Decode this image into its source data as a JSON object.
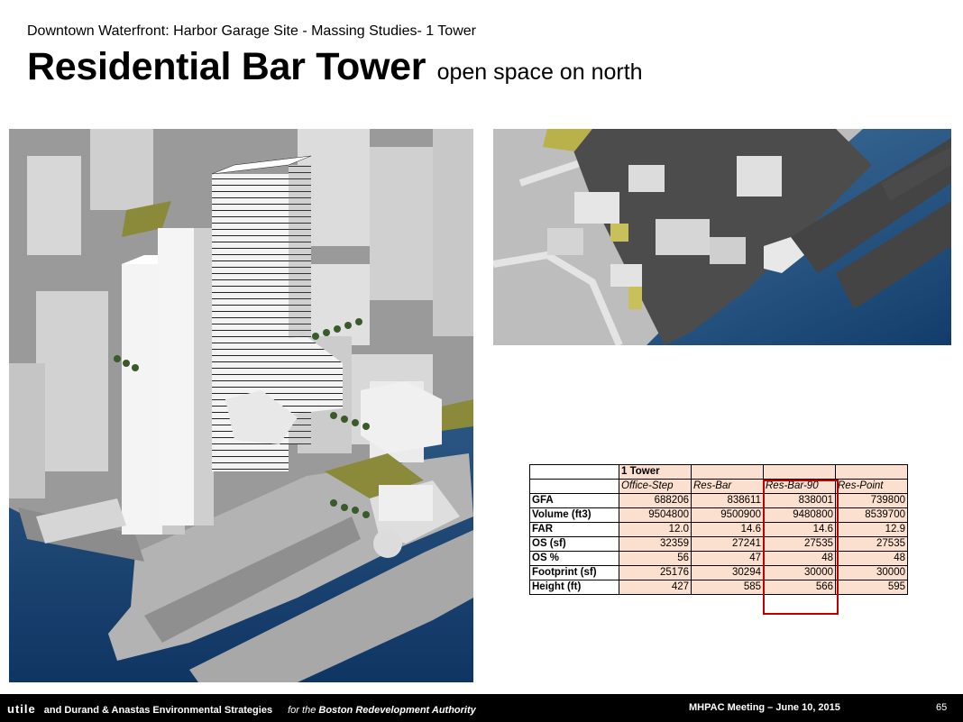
{
  "header": {
    "subtitle": "Downtown Waterfront: Harbor Garage Site - Massing Studies- 1 Tower",
    "title": "Residential Bar Tower",
    "title_suffix": "open space on north"
  },
  "table": {
    "group_label": "1 Tower",
    "columns": [
      "Office-Step",
      "Res-Bar",
      "Res-Bar-90",
      "Res-Point"
    ],
    "highlighted_column": "Res-Bar-90",
    "rows": [
      {
        "label": "GFA",
        "values": [
          "688206",
          "838611",
          "838001",
          "739800"
        ]
      },
      {
        "label": "Volume (ft3)",
        "values": [
          "9504800",
          "9500900",
          "9480800",
          "8539700"
        ]
      },
      {
        "label": "FAR",
        "values": [
          "12.0",
          "14.6",
          "14.6",
          "12.9"
        ]
      },
      {
        "label": "OS (sf)",
        "values": [
          "32359",
          "27241",
          "27535",
          "27535"
        ]
      },
      {
        "label": "OS %",
        "values": [
          "56",
          "47",
          "48",
          "48"
        ]
      },
      {
        "label": "Footprint (sf)",
        "values": [
          "25176",
          "30294",
          "30000",
          "30000"
        ]
      },
      {
        "label": "Height (ft)",
        "values": [
          "427",
          "585",
          "566",
          "595"
        ]
      }
    ]
  },
  "footer": {
    "brand": "utile",
    "credit": "and Durand & Anastas Environmental Strategies",
    "for_text": "for the",
    "client": "Boston Redevelopment Authority",
    "meeting": "MHPAC Meeting  – June 10, 2015",
    "page": "65"
  },
  "colors": {
    "table_fill": "#fbe0cf",
    "highlight_border": "#c00000",
    "water_top": "#4a7aa5",
    "water_bottom": "#0f3563"
  }
}
